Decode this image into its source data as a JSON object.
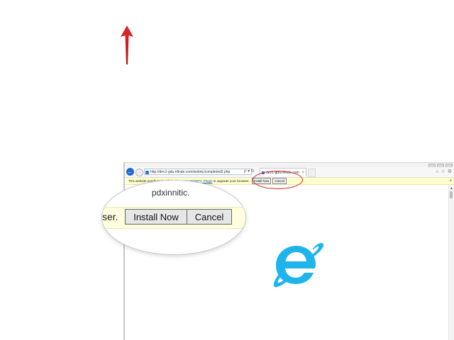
{
  "browser": {
    "address_url": "http://dev1-gdu.nfinde.com/webrtc/completed2.php",
    "address_icons": "ρ ▾ ↻",
    "tab_title": "dev1-gdu.nfinde.com",
    "tab_close": "×",
    "back_glyph": "←",
    "forward_glyph": "→"
  },
  "infobar": {
    "text_before": "This website needs to install the ",
    "link_text": "Temasys WebRTC Plugin",
    "text_after": " to upgrade your browser.",
    "install_label": "Install Now",
    "cancel_label": "Cancel",
    "close_glyph": "×"
  },
  "magnifier": {
    "top_text": "pdxinnitic.",
    "ser_text": "ser.",
    "install_label": "Install Now",
    "cancel_label": "Cancel"
  },
  "colors": {
    "arrow": "#d9232b",
    "highlight": "#d9232b",
    "infobar_bg": "#ffffcc",
    "ie_logo": "#1fb5ec"
  },
  "icons": [
    "arrow-up-icon",
    "back-icon",
    "forward-icon",
    "ie-logo-icon",
    "home-icon",
    "star-icon",
    "gear-icon"
  ]
}
